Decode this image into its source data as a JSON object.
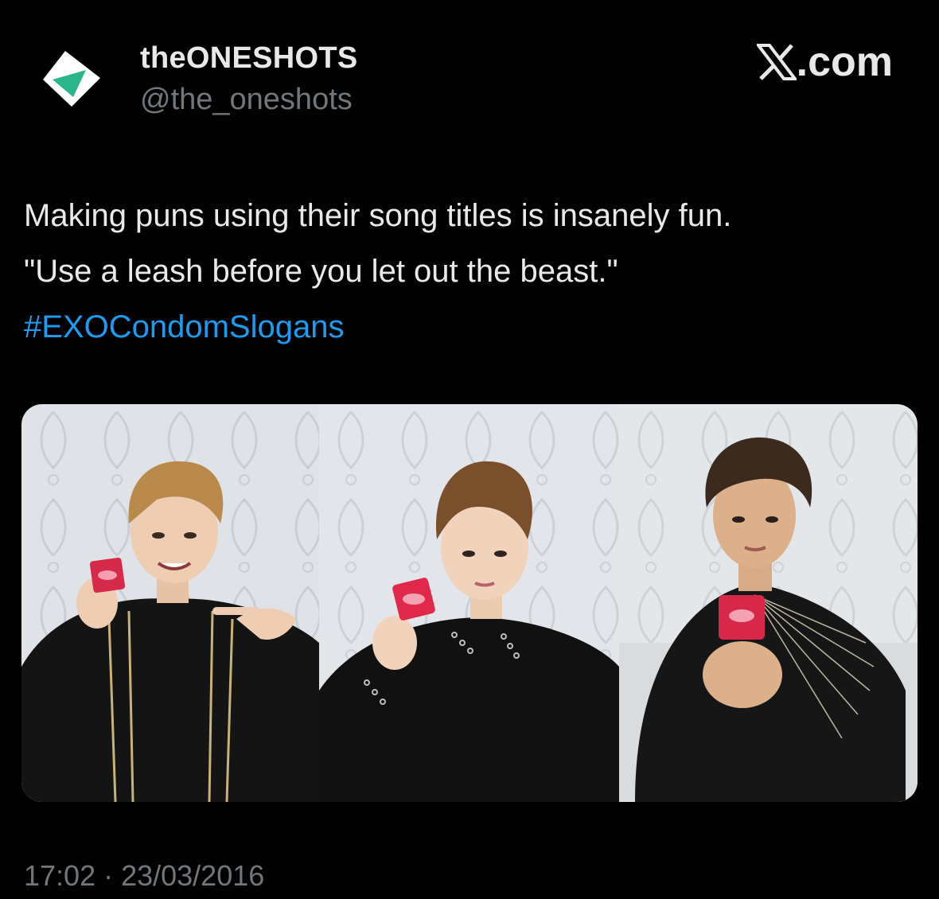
{
  "author": {
    "display_name": "theONESHOTS",
    "handle": "@the_oneshots",
    "avatar_icon": "green-diamond-logo-icon",
    "avatar_colors": [
      "#2bb58a",
      "#ffffff"
    ]
  },
  "site": {
    "logo_icon": "x-logo-icon",
    "domain": ".com"
  },
  "tweet": {
    "line1": "Making puns using their song titles is insanely fun.",
    "line2": "\"Use a leash before you let out the beast.\"",
    "hashtag": "#EXOCondomSlogans",
    "hashtag_color": "#1d9bf0"
  },
  "media": {
    "photo_count": 3
  },
  "meta": {
    "timestamp": "17:02 · 23/03/2016"
  }
}
